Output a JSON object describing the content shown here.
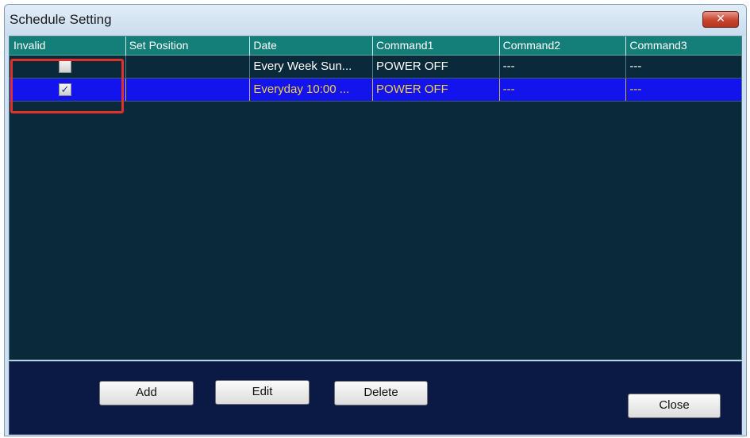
{
  "window": {
    "title": "Schedule Setting",
    "close_glyph": "✕"
  },
  "table": {
    "columns": [
      "Invalid",
      "Set Position",
      "Date",
      "Command1",
      "Command2",
      "Command3"
    ],
    "rows": [
      {
        "invalid": false,
        "set_position": "",
        "date": "Every Week Sun...",
        "command1": "POWER OFF",
        "command2": "---",
        "command3": "---",
        "selected": false
      },
      {
        "invalid": true,
        "set_position": "",
        "date": "Everyday 10:00 ...",
        "command1": "POWER OFF",
        "command2": "---",
        "command3": "---",
        "selected": true
      }
    ]
  },
  "buttons": {
    "add": "Add",
    "edit": "Edit",
    "delete": "Delete",
    "close": "Close"
  },
  "colors": {
    "header_bg": "#147f78",
    "list_bg": "#0a2a3a",
    "selected_row_bg": "#1313ee",
    "selected_row_text": "#f2d33a",
    "highlight_border": "#e0312b"
  },
  "icons": {
    "checkbox_checked": "✓"
  }
}
